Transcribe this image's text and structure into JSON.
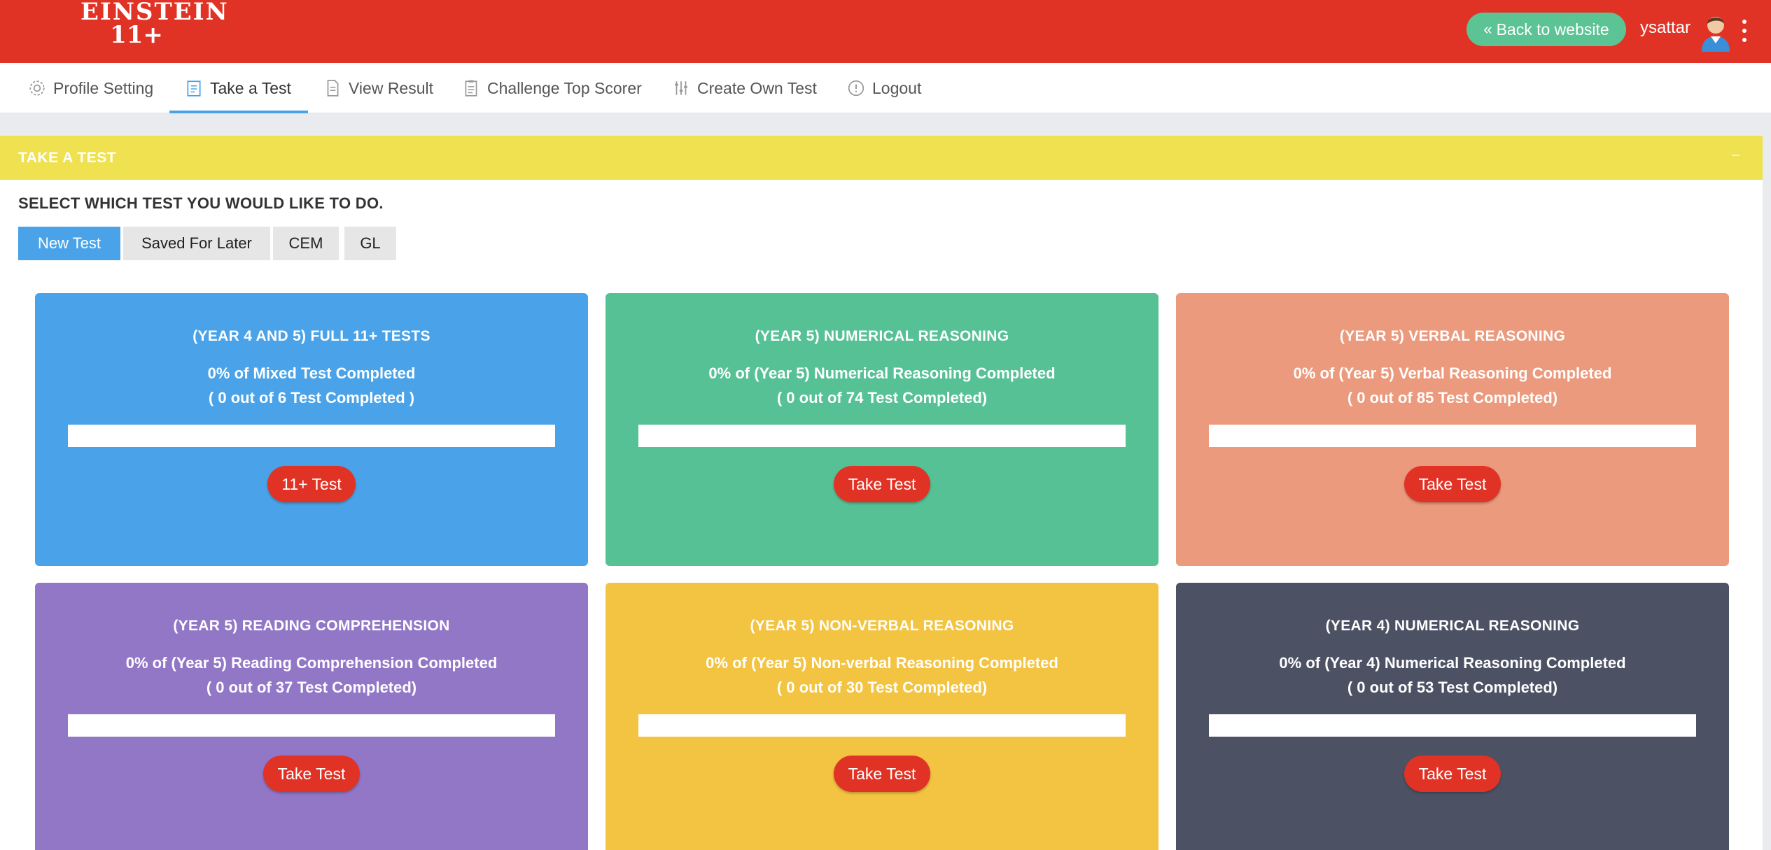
{
  "header": {
    "logo_line1": "EINSTEIN",
    "logo_line2": "11+",
    "back_label": "Back to website",
    "username": "ysattar"
  },
  "nav": {
    "items": [
      {
        "label": "Profile Setting",
        "icon": "gear-icon"
      },
      {
        "label": "Take a Test",
        "icon": "clipboard-icon",
        "active": true
      },
      {
        "label": "View Result",
        "icon": "document-icon"
      },
      {
        "label": "Challenge Top Scorer",
        "icon": "clipboard-list-icon"
      },
      {
        "label": "Create Own Test",
        "icon": "sliders-icon"
      },
      {
        "label": "Logout",
        "icon": "info-circle-icon"
      }
    ]
  },
  "panel": {
    "title": "TAKE A TEST",
    "collapse": "–",
    "prompt": "SELECT WHICH TEST YOU WOULD LIKE TO DO."
  },
  "tabs": [
    {
      "label": "New Test",
      "active": true
    },
    {
      "label": "Saved For Later"
    },
    {
      "label": "CEM"
    },
    {
      "label": "GL"
    }
  ],
  "cards": [
    {
      "title": "(YEAR 4 AND 5) FULL 11+ TESTS",
      "line1": "0% of Mixed Test Completed",
      "line2": "( 0 out of 6 Test Completed )",
      "progress": 0,
      "button": "11+ Test",
      "color": "#4aa3e8"
    },
    {
      "title": "(YEAR 5) NUMERICAL REASONING",
      "line1": "0% of (Year 5) Numerical Reasoning Completed",
      "line2": "( 0 out of 74 Test Completed)",
      "progress": 0,
      "button": "Take Test",
      "color": "#57c196"
    },
    {
      "title": "(YEAR 5) VERBAL REASONING",
      "line1": "0% of (Year 5) Verbal Reasoning Completed",
      "line2": "( 0 out of 85 Test Completed)",
      "progress": 0,
      "button": "Take Test",
      "color": "#eb9a7d"
    },
    {
      "title": "(YEAR 5) READING COMPREHENSION",
      "line1": "0% of (Year 5) Reading Comprehension Completed",
      "line2": "( 0 out of 37 Test Completed)",
      "progress": 0,
      "button": "Take Test",
      "color": "#9277c7"
    },
    {
      "title": "(YEAR 5) NON-VERBAL REASONING",
      "line1": "0% of (Year 5) Non-verbal Reasoning Completed",
      "line2": "( 0 out of 30 Test Completed)",
      "progress": 0,
      "button": "Take Test",
      "color": "#f3c342"
    },
    {
      "title": "(YEAR 4) NUMERICAL REASONING",
      "line1": "0% of (Year 4) Numerical Reasoning Completed",
      "line2": "( 0 out of 53 Test Completed)",
      "progress": 0,
      "button": "Take Test",
      "color": "#4c5264"
    }
  ]
}
